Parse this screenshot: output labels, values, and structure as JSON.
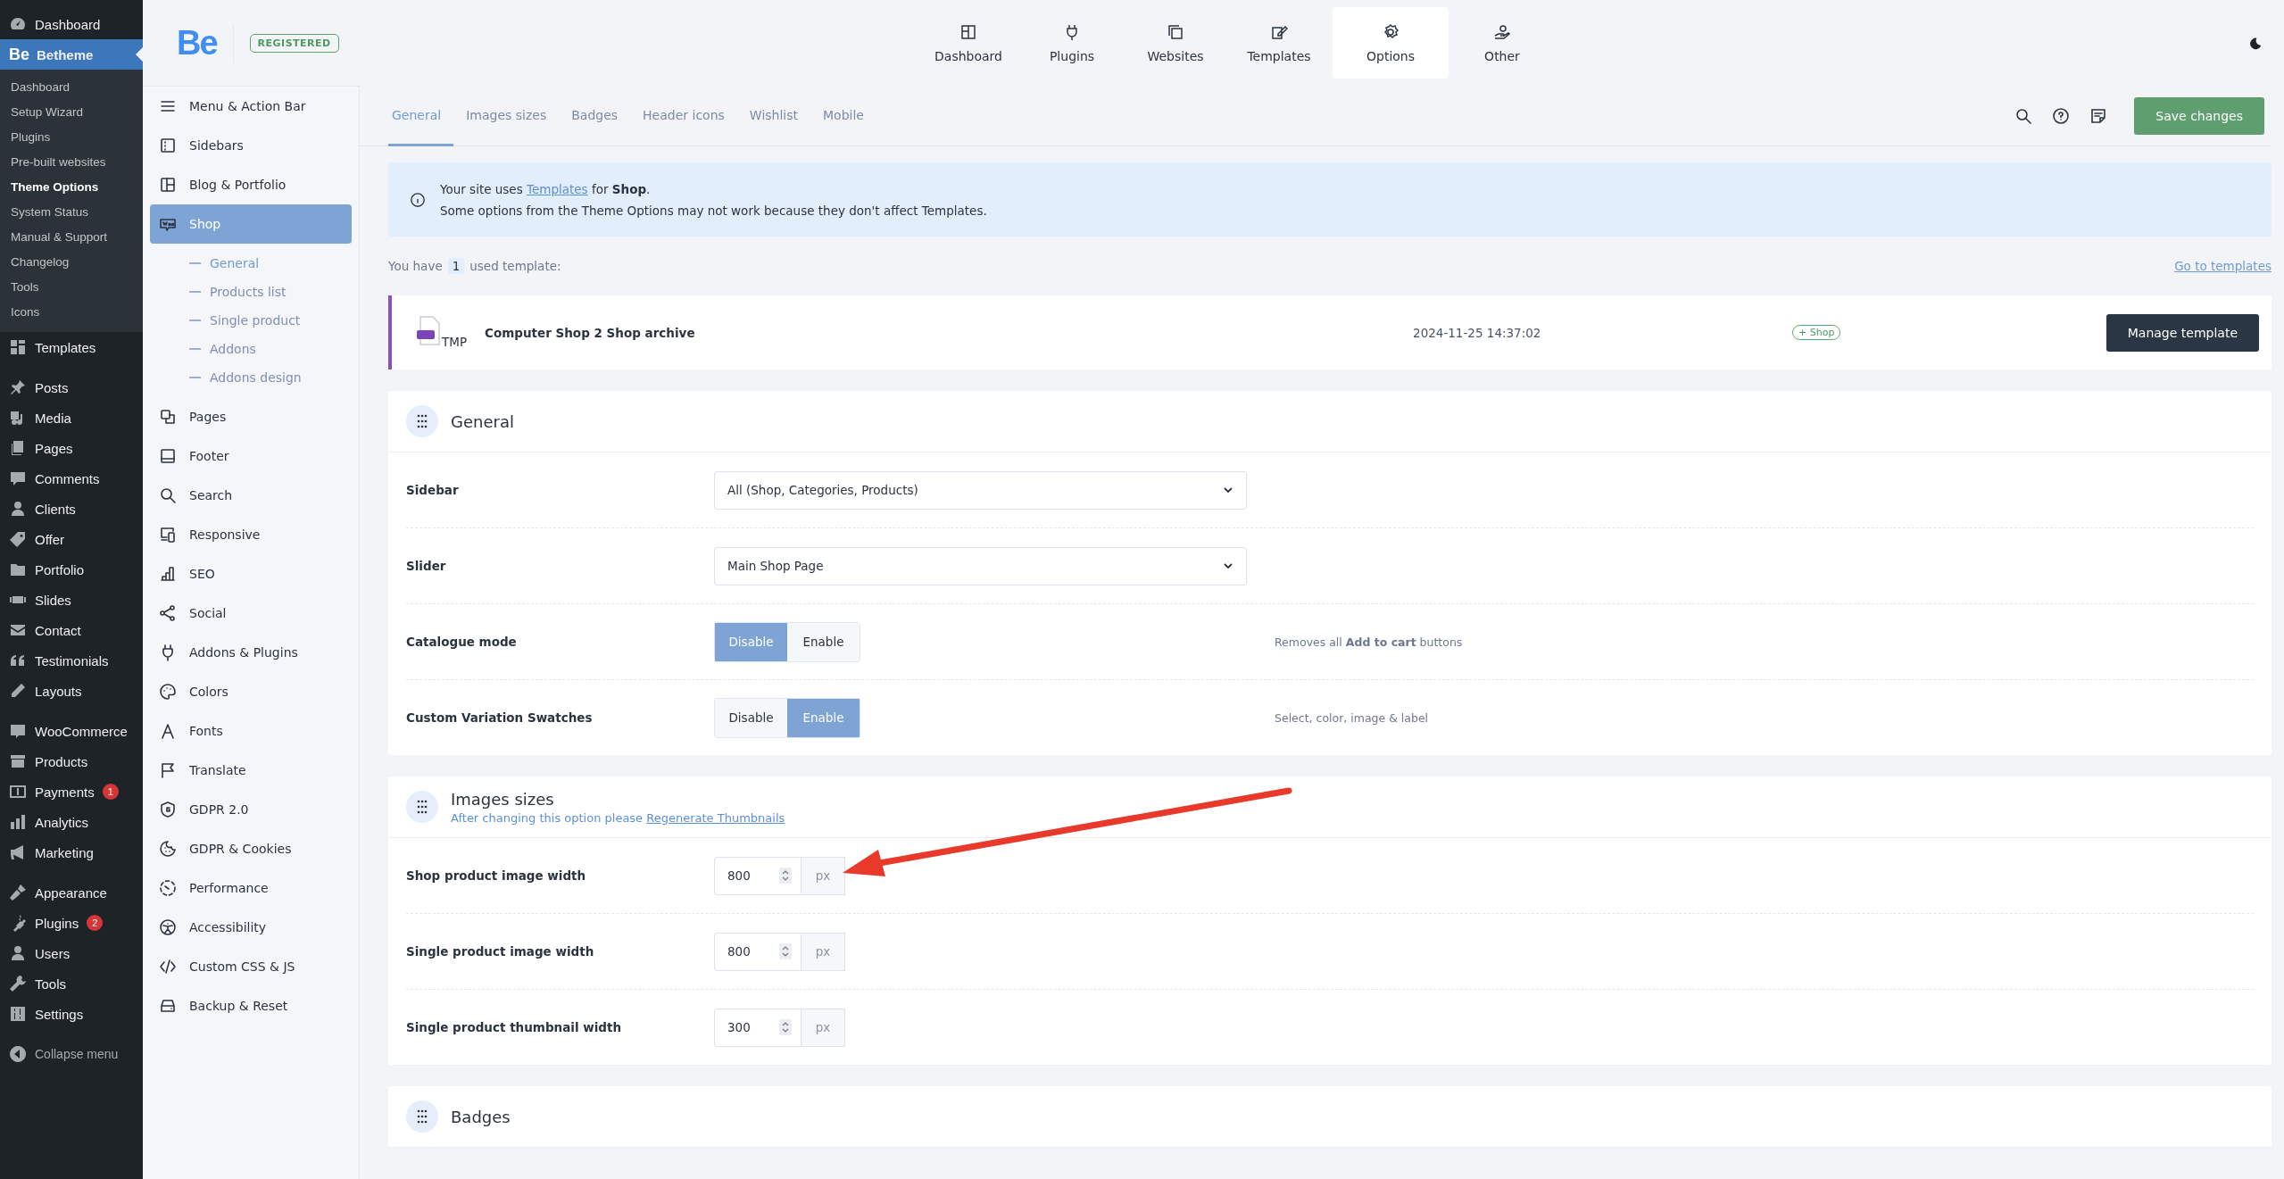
{
  "admin_menu": {
    "sections": [
      {
        "items": [
          {
            "label": "Dashboard",
            "selected": false
          },
          {
            "label": "Betheme",
            "logo": "Be",
            "selected": true,
            "children": [
              {
                "label": "Dashboard",
                "selected": false
              },
              {
                "label": "Setup Wizard",
                "selected": false
              },
              {
                "label": "Plugins",
                "selected": false
              },
              {
                "label": "Pre-built websites",
                "selected": false
              },
              {
                "label": "Theme Options",
                "selected": true
              },
              {
                "label": "System Status",
                "selected": false
              },
              {
                "label": "Manual & Support",
                "selected": false
              },
              {
                "label": "Changelog",
                "selected": false
              },
              {
                "label": "Tools",
                "selected": false
              },
              {
                "label": "Icons",
                "selected": false
              }
            ]
          },
          {
            "label": "Templates",
            "selected": false
          }
        ]
      },
      {
        "items": [
          {
            "label": "Posts",
            "selected": false
          },
          {
            "label": "Media",
            "selected": false
          },
          {
            "label": "Pages",
            "selected": false
          },
          {
            "label": "Comments",
            "selected": false
          },
          {
            "label": "Clients",
            "selected": false
          },
          {
            "label": "Offer",
            "selected": false
          },
          {
            "label": "Portfolio",
            "selected": false
          },
          {
            "label": "Slides",
            "selected": false
          },
          {
            "label": "Contact",
            "selected": false
          },
          {
            "label": "Testimonials",
            "selected": false
          },
          {
            "label": "Layouts",
            "selected": false
          }
        ]
      },
      {
        "items": [
          {
            "label": "WooCommerce",
            "selected": false
          },
          {
            "label": "Products",
            "selected": false
          },
          {
            "label": "Payments",
            "badge": "1",
            "selected": false
          },
          {
            "label": "Analytics",
            "selected": false
          },
          {
            "label": "Marketing",
            "selected": false
          }
        ]
      },
      {
        "items": [
          {
            "label": "Appearance",
            "selected": false
          },
          {
            "label": "Plugins",
            "badge": "2",
            "selected": false
          },
          {
            "label": "Users",
            "selected": false
          },
          {
            "label": "Tools",
            "selected": false
          },
          {
            "label": "Settings",
            "selected": false
          }
        ]
      }
    ],
    "collapse": "Collapse menu"
  },
  "brand": {
    "logo": "Be",
    "badge": "REGISTERED"
  },
  "top_nav": [
    {
      "label": "Dashboard",
      "selected": false
    },
    {
      "label": "Plugins",
      "selected": false
    },
    {
      "label": "Websites",
      "selected": false
    },
    {
      "label": "Templates",
      "selected": false
    },
    {
      "label": "Options",
      "selected": true
    },
    {
      "label": "Other",
      "selected": false
    }
  ],
  "theme_menu": [
    {
      "label": "Menu & Action Bar",
      "selected": false
    },
    {
      "label": "Sidebars",
      "selected": false
    },
    {
      "label": "Blog & Portfolio",
      "selected": false
    },
    {
      "label": "Shop",
      "selected": true,
      "children": [
        {
          "label": "General",
          "selected": true
        },
        {
          "label": "Products list",
          "selected": false
        },
        {
          "label": "Single product",
          "selected": false
        },
        {
          "label": "Addons",
          "selected": false
        },
        {
          "label": "Addons design",
          "selected": false
        }
      ]
    },
    {
      "label": "Pages",
      "selected": false
    },
    {
      "label": "Footer",
      "selected": false
    },
    {
      "label": "Search",
      "selected": false
    },
    {
      "label": "Responsive",
      "selected": false
    },
    {
      "label": "SEO",
      "selected": false
    },
    {
      "label": "Social",
      "selected": false
    },
    {
      "label": "Addons & Plugins",
      "selected": false
    },
    {
      "label": "Colors",
      "selected": false
    },
    {
      "label": "Fonts",
      "selected": false
    },
    {
      "label": "Translate",
      "selected": false
    },
    {
      "label": "GDPR 2.0",
      "selected": false
    },
    {
      "label": "GDPR & Cookies",
      "selected": false
    },
    {
      "label": "Performance",
      "selected": false
    },
    {
      "label": "Accessibility",
      "selected": false
    },
    {
      "label": "Custom CSS & JS",
      "selected": false
    },
    {
      "label": "Backup & Reset",
      "selected": false
    }
  ],
  "tabs": [
    {
      "label": "General",
      "selected": true
    },
    {
      "label": "Images sizes",
      "selected": false
    },
    {
      "label": "Badges",
      "selected": false
    },
    {
      "label": "Header icons",
      "selected": false
    },
    {
      "label": "Wishlist",
      "selected": false
    },
    {
      "label": "Mobile",
      "selected": false
    }
  ],
  "save_button": "Save changes",
  "notice": {
    "before": "Your site uses ",
    "link": "Templates",
    "after": " for **Shop**.",
    "line_2": "Some options from the Theme Options may not work because they don't affect Templates."
  },
  "used_templates": {
    "before": "You have",
    "count": "1",
    "after": "used template:",
    "link": "Go to templates"
  },
  "template": {
    "icon_label": "TMP",
    "name": "Computer Shop 2 Shop archive",
    "date": "2024-11-25 14:37:02",
    "tag": "+ Shop",
    "button": "Manage template"
  },
  "sections": [
    {
      "title": "General",
      "rows": [
        {
          "kind": "select",
          "label": "Sidebar",
          "value": "All (Shop, Categories, Products)"
        },
        {
          "kind": "select",
          "label": "Slider",
          "value": "Main Shop Page"
        },
        {
          "kind": "toggle",
          "label": "Catalogue mode",
          "options": [
            {
              "label": "Disable",
              "selected": true
            },
            {
              "label": "Enable",
              "selected": false
            }
          ],
          "description": "Removes all **Add to cart** buttons"
        },
        {
          "kind": "toggle",
          "label": "Custom Variation Swatches",
          "options": [
            {
              "label": "Disable",
              "selected": false
            },
            {
              "label": "Enable",
              "selected": true
            }
          ],
          "description": "Select, color, image & label"
        }
      ]
    },
    {
      "title": "Images sizes",
      "subtitle": {
        "before": "After changing this option please ",
        "link": "Regenerate Thumbnails"
      },
      "rows": [
        {
          "kind": "number",
          "label": "Shop product image width",
          "value": "800",
          "unit": "px"
        },
        {
          "kind": "number",
          "label": "Single product image width",
          "value": "800",
          "unit": "px"
        },
        {
          "kind": "number",
          "label": "Single product thumbnail width",
          "value": "300",
          "unit": "px"
        }
      ]
    },
    {
      "title": "Badges"
    }
  ],
  "annotation": {
    "kind": "arrow"
  }
}
